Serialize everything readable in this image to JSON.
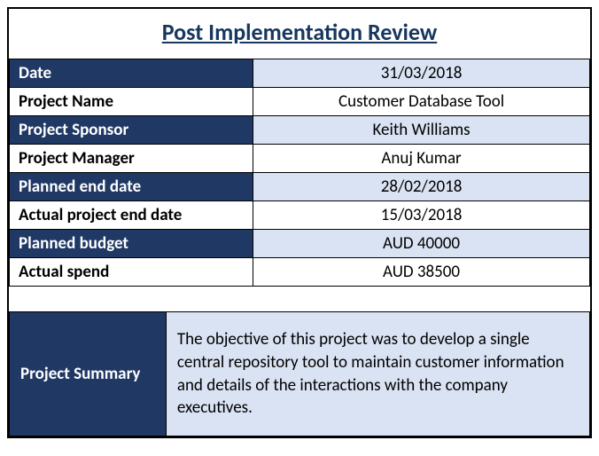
{
  "title": "Post Implementation Review",
  "rows": [
    {
      "label": "Date",
      "value": "31/03/2018"
    },
    {
      "label": "Project Name",
      "value": "Customer Database Tool"
    },
    {
      "label": "Project Sponsor",
      "value": "Keith Williams"
    },
    {
      "label": "Project Manager",
      "value": "Anuj Kumar"
    },
    {
      "label": "Planned end date",
      "value": "28/02/2018"
    },
    {
      "label": "Actual project end date",
      "value": "15/03/2018"
    },
    {
      "label": "Planned budget",
      "value": "AUD 40000"
    },
    {
      "label": "Actual spend",
      "value": "AUD 38500"
    }
  ],
  "summary": {
    "label": "Project Summary",
    "body": "The objective of this project was to develop a single central repository tool to maintain customer information and details of the interactions with the company executives."
  }
}
